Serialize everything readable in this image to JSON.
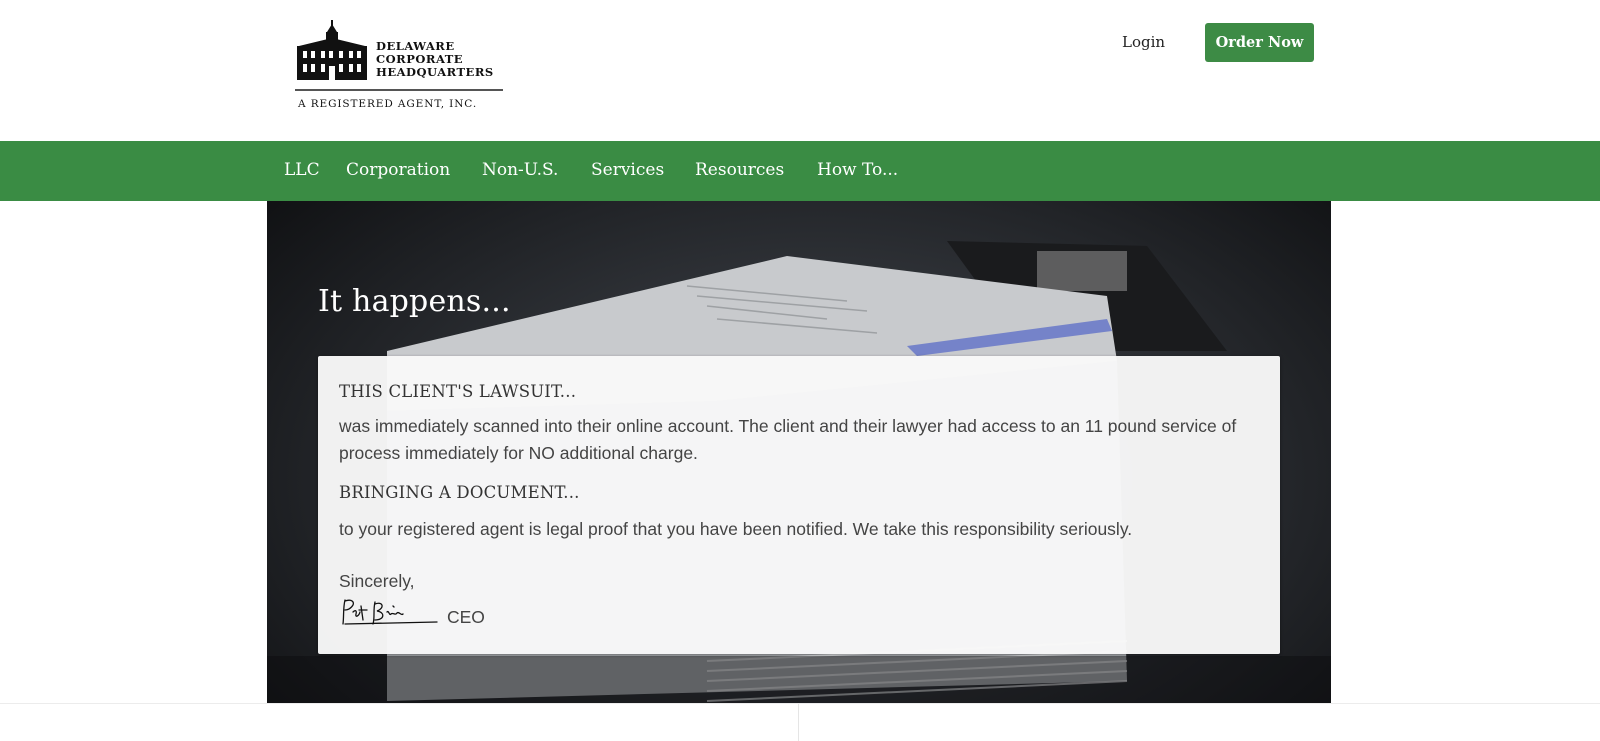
{
  "header": {
    "logo": {
      "line1": "DELAWARE",
      "line2": "CORPORATE",
      "line3": "HEADQUARTERS",
      "tagline": "A REGISTERED AGENT, INC."
    },
    "login_label": "Login",
    "order_label": "Order Now"
  },
  "nav": {
    "items": [
      {
        "label": "LLC"
      },
      {
        "label": "Corporation"
      },
      {
        "label": "Non-U.S."
      },
      {
        "label": "Services"
      },
      {
        "label": "Resources"
      },
      {
        "label": "How To..."
      }
    ]
  },
  "hero": {
    "title": "It happens...",
    "card": {
      "heading1": "THIS CLIENT'S LAWSUIT...",
      "paragraph1": "was immediately scanned into their online account. The client and their lawyer had access to an 11 pound service of process immediately for NO additional charge.",
      "heading2": "BRINGING A DOCUMENT...",
      "paragraph2": "to your registered agent is legal proof that you have been notified. We take this responsibility seriously.",
      "closing": "Sincerely,",
      "signer_title": "CEO"
    }
  },
  "colors": {
    "brand_green": "#3a8c44",
    "button_green": "#3d8b45"
  }
}
